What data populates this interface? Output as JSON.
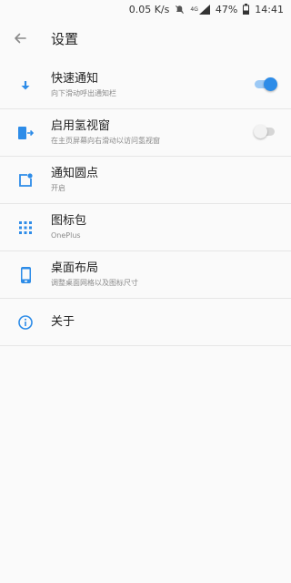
{
  "status_bar": {
    "speed": "0.05 K/s",
    "network": "4G",
    "battery": "47%",
    "time": "14:41"
  },
  "header": {
    "title": "设置"
  },
  "settings": [
    {
      "title": "快速通知",
      "subtitle": "向下滑动呼出通知栏",
      "icon": "download-arrow-icon",
      "toggle": "on"
    },
    {
      "title": "启用氢视窗",
      "subtitle": "在主页屏幕向右滑动以访问氢视窗",
      "icon": "shelf-icon",
      "toggle": "off"
    },
    {
      "title": "通知圆点",
      "subtitle": "开启",
      "icon": "notification-dot-icon"
    },
    {
      "title": "图标包",
      "subtitle": "OnePlus",
      "icon": "grid-icon"
    },
    {
      "title": "桌面布局",
      "subtitle": "调整桌面网格以及图标尺寸",
      "icon": "phone-icon"
    },
    {
      "title": "关于",
      "subtitle": "",
      "icon": "info-icon"
    }
  ],
  "colors": {
    "accent": "#2d8ce8",
    "background": "#fafafa"
  }
}
